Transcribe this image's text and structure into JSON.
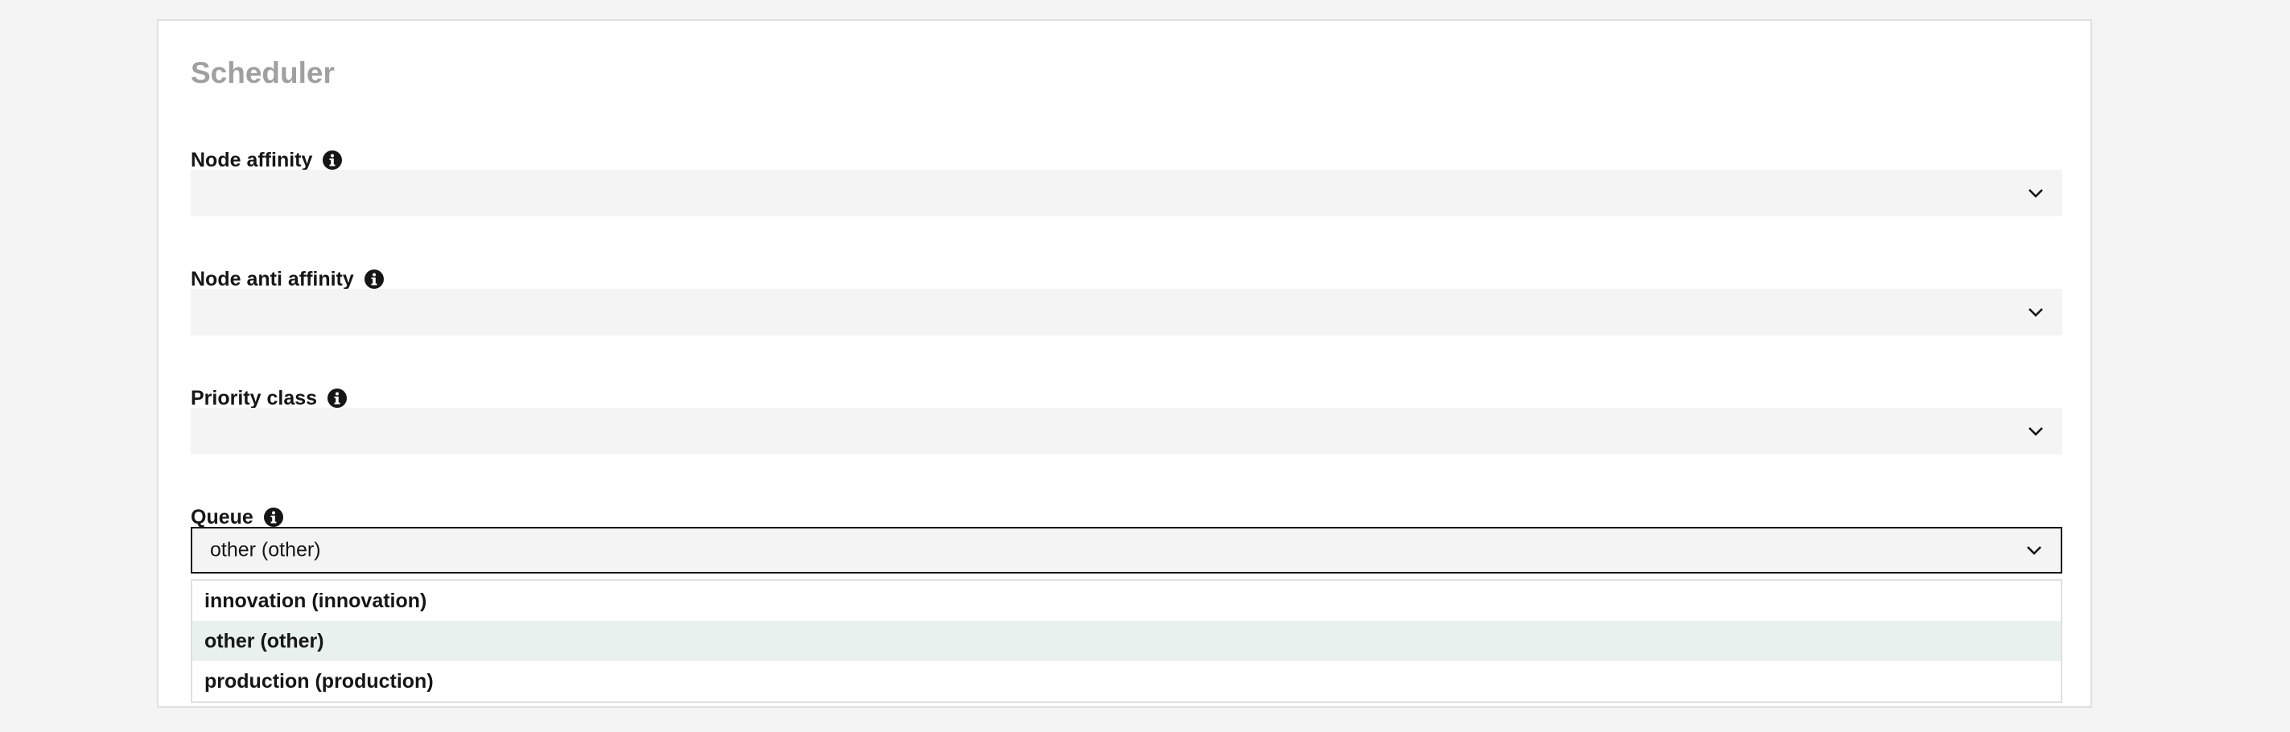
{
  "section": {
    "title": "Scheduler"
  },
  "fields": {
    "node_affinity": {
      "label": "Node affinity",
      "value": ""
    },
    "node_anti_affinity": {
      "label": "Node anti affinity",
      "value": ""
    },
    "priority_class": {
      "label": "Priority class",
      "value": ""
    },
    "queue": {
      "label": "Queue",
      "value": "other (other)",
      "options": [
        "innovation (innovation)",
        "other (other)",
        "production (production)"
      ],
      "highlighted_option": "other (other)"
    }
  },
  "icons": {
    "info": "info-icon",
    "dropdown": "chevron-down-icon"
  },
  "colors": {
    "page_background": "#f4f4f4",
    "panel_background": "#ffffff",
    "field_background": "#f4f4f4",
    "highlight": "#e8f1ed",
    "title_text": "#a0a0a0",
    "text": "#161616"
  }
}
